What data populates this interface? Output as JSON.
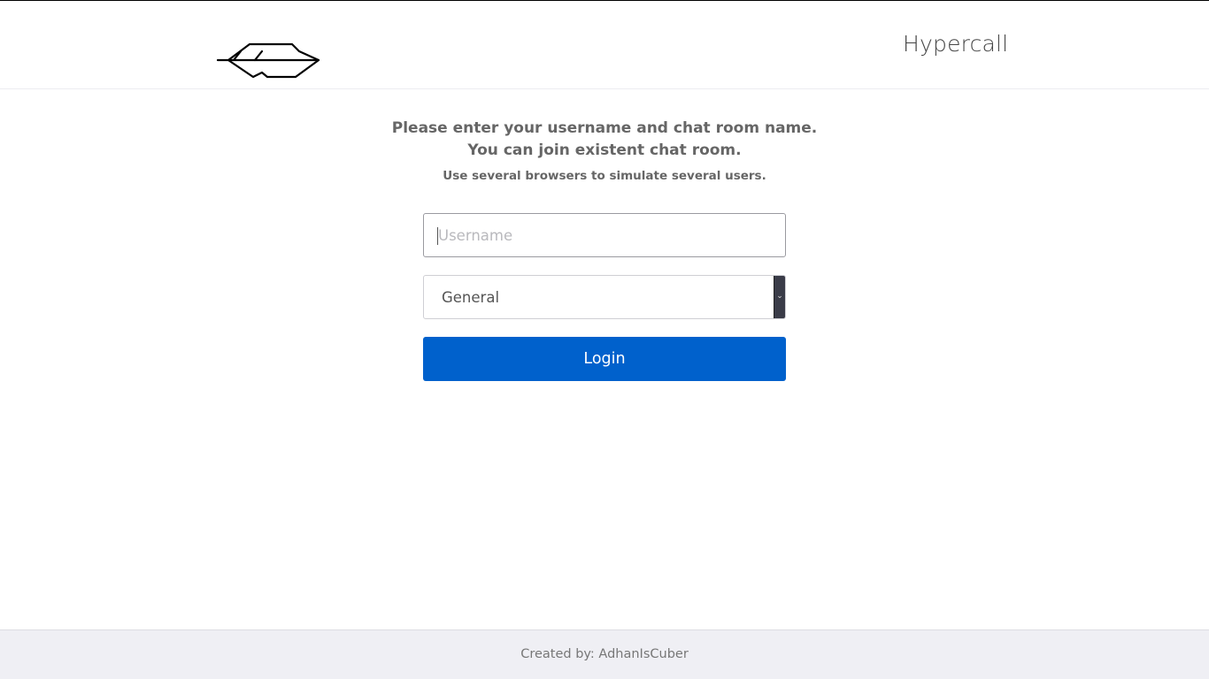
{
  "header": {
    "logo_icon": "feather-icon",
    "brand": "Hypercall"
  },
  "intro": {
    "line1": "Please enter your username and chat room name.",
    "line2": "You can join existent chat room.",
    "hint": "Use several browsers to simulate several users."
  },
  "form": {
    "username_placeholder": "Username",
    "username_value": "",
    "room_selected": "General",
    "room_arrow_icon": "chevron-down-icon",
    "login_label": "Login"
  },
  "colors": {
    "primary": "#0061cc",
    "footer_bg": "#efeff4"
  },
  "footer": {
    "text": "Created by: AdhanIsCuber"
  }
}
